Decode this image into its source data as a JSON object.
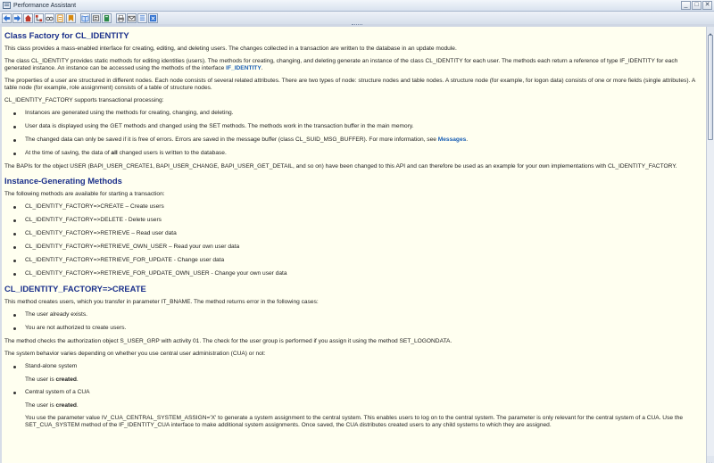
{
  "window": {
    "title": "Performance Assistant",
    "minimize_label": "_",
    "maximize_label": "□",
    "close_label": "✕"
  },
  "toolbar": {
    "buttons": [
      {
        "icon": "back-arrow-icon",
        "color": "#2d6fcf"
      },
      {
        "icon": "forward-arrow-icon",
        "color": "#2d6fcf"
      },
      {
        "icon": "home-icon",
        "color": "#c0392b"
      },
      {
        "icon": "tree-structure-icon",
        "color": "#c0392b"
      },
      {
        "icon": "glasses-icon",
        "color": "#444444"
      },
      {
        "icon": "document-settings-icon",
        "color": "#d68910"
      },
      {
        "icon": "bookmark-icon",
        "color": "#d68910"
      },
      {
        "icon": "open-book-icon",
        "color": "#2d6fcf"
      },
      {
        "icon": "technical-info-icon",
        "color": "#555555"
      },
      {
        "icon": "glossary-icon",
        "color": "#2d8a4a"
      },
      {
        "icon": "print-icon",
        "color": "#555555"
      },
      {
        "icon": "mail-icon",
        "color": "#555555"
      },
      {
        "icon": "docs-list-icon",
        "color": "#2d6fcf"
      },
      {
        "icon": "close-window-icon",
        "color": "#2d6fcf"
      }
    ]
  },
  "doc": {
    "h1": "Class Factory for CL_IDENTITY",
    "p1": "This class provides a mass-enabled interface for creating, editing, and deleting users. The changes collected in a transaction are written to the database in an update module.",
    "p2_text": "The class CL_IDENTITY provides static methods for editing identities (users). The methods for creating, changing, and deleting generate an instance of the class CL_IDENTITY for each user. The methods each return a reference of type IF_IDENTITY for each generated instance. An instance can be accessed using the methods of the interface ",
    "p2_link": "IF_IDENTITY",
    "p2_end": ".",
    "p3": "The properties of a user are structured in different nodes. Each node consists of several related attributes. There are two types of node: structure nodes and table nodes. A structure node (for example, for logon data) consists of one or more fields (single attributes). A table node (for example, role assignment) consists of a table of structure nodes.",
    "p4": "CL_IDENTITY_FACTORY supports transactional processing:",
    "list1": [
      "Instances are generated using the methods for creating, changing, and deleting.",
      "User data is displayed using the GET methods and changed using the SET methods. The methods work in the transaction buffer in the main memory."
    ],
    "li3_text": "The changed data can only be saved if it is free of errors. Errors are saved in the message buffer (class CL_SUID_MSG_BUFFER). For more information, see ",
    "li3_link": "Messages",
    "li3_end": ".",
    "li4_a": "At the time of saving, the data of ",
    "li4_b": "all",
    "li4_c": " changed users is written to the database.",
    "p5": "The BAPIs for the object USER (BAPI_USER_CREATE1, BAPI_USER_CHANGE, BAPI_USER_GET_DETAIL, and so on) have been changed to this API and can therefore be used as an example for your own implementations with CL_IDENTITY_FACTORY.",
    "h2": "Instance-Generating Methods",
    "p6": "The following methods are available for starting a transaction:",
    "methods": [
      "CL_IDENTITY_FACTORY=>CREATE – Create users",
      "CL_IDENTITY_FACTORY=>DELETE - Delete users",
      "CL_IDENTITY_FACTORY=>RETRIEVE – Read user data",
      "CL_IDENTITY_FACTORY=>RETRIEVE_OWN_USER – Read your own user data",
      "CL_IDENTITY_FACTORY=>RETRIEVE_FOR_UPDATE - Change user data",
      "CL_IDENTITY_FACTORY=>RETRIEVE_FOR_UPDATE_OWN_USER - Change your own user data"
    ],
    "h3": "CL_IDENTITY_FACTORY=>CREATE",
    "p7": "This method creates users, which you transfer in parameter IT_BNAME. The method returns error in the following cases:",
    "errors": [
      "The user already exists.",
      "You are not authorized to create users."
    ],
    "p8": "The method checks the authorization object S_USER_GRP with activity 01. The check for the user group is performed if you assign it using the method SET_LOGONDATA.",
    "p9": "The system behavior varies depending on whether you use central user administration (CUA) or not:",
    "case1": "Stand-alone system",
    "case1_a": "The user is ",
    "case1_b": "created",
    "case1_c": ".",
    "case2": "Central system of a CUA",
    "case2_a": "The user is ",
    "case2_b": "created",
    "case2_c": ".",
    "p10": "You use the parameter value IV_CUA_CENTRAL_SYSTEM_ASSIGN='X' to generate a system assignment to the central system. This enables users to log on to the central system. The parameter is only relevant for the central system of a CUA. Use the SET_CUA_SYSTEM method of the IF_IDENTITY_CUA interface to make additional system assignments. Once saved, the CUA distributes created users to any child systems to which they are assigned."
  }
}
